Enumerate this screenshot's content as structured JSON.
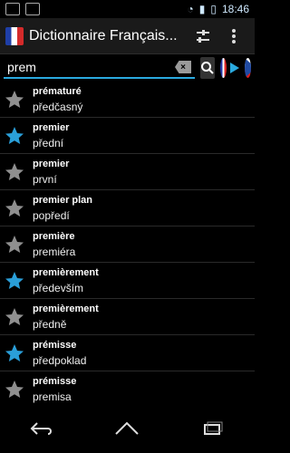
{
  "status": {
    "time": "18:46"
  },
  "app": {
    "title": "Dictionnaire Français..."
  },
  "search": {
    "value": "prem",
    "placeholder": ""
  },
  "languages": {
    "from": "Français",
    "to": "Čeština"
  },
  "colors": {
    "accent": "#2aa9df",
    "star_active": "#2a9fd9",
    "star_inactive": "#8f8f8f"
  },
  "entries": [
    {
      "fr": "prématuré",
      "cz": "předčasný",
      "starred": false
    },
    {
      "fr": "premier",
      "cz": "přední",
      "starred": true
    },
    {
      "fr": "premier",
      "cz": "první",
      "starred": false
    },
    {
      "fr": "premier plan",
      "cz": "popředí",
      "starred": false
    },
    {
      "fr": "première",
      "cz": "premiéra",
      "starred": false
    },
    {
      "fr": "premièrement",
      "cz": "především",
      "starred": true
    },
    {
      "fr": "premièrement",
      "cz": "předně",
      "starred": false
    },
    {
      "fr": "prémisse",
      "cz": "předpoklad",
      "starred": true
    },
    {
      "fr": "prémisse",
      "cz": "premisa",
      "starred": false
    }
  ]
}
